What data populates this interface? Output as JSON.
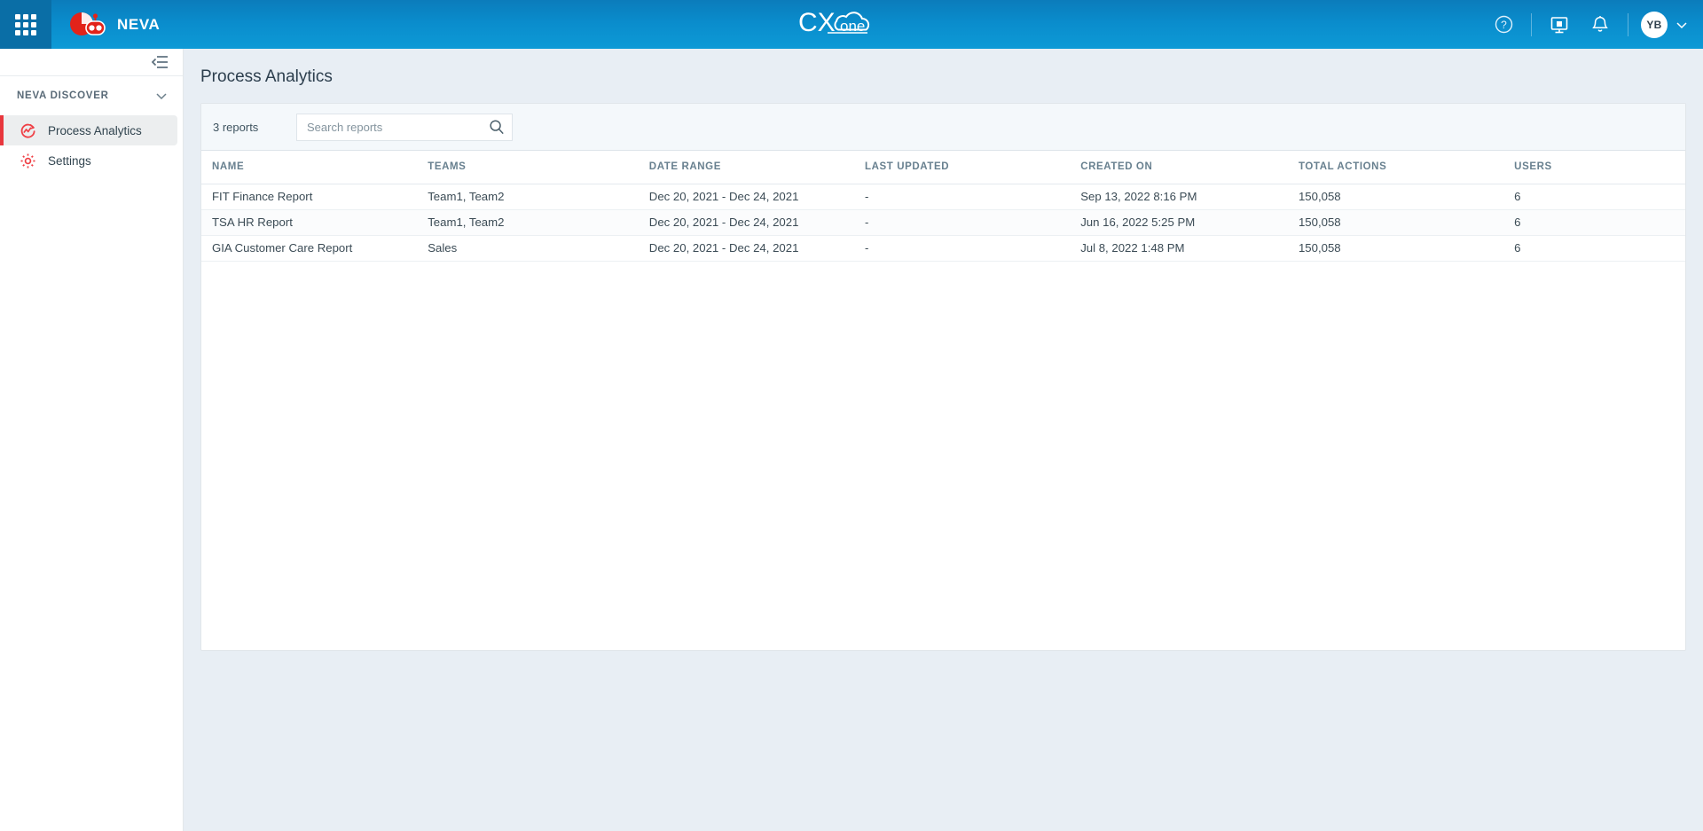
{
  "topbar": {
    "apps_launcher_name": "App launcher",
    "brand_name": "NEVA",
    "product_logo_main": "CX",
    "product_logo_sub": "one",
    "help_icon": "help-circle-icon",
    "dashboard_icon": "presentation-screen-icon",
    "notifications_icon": "bell-icon",
    "avatar_initials": "YB",
    "avatar_chevron": "chevron-down-icon"
  },
  "sidebar": {
    "collapse_icon": "collapse-panel-icon",
    "section": {
      "label": "NEVA DISCOVER",
      "chevron": "chevron-down-icon"
    },
    "items": [
      {
        "label": "Process Analytics",
        "icon": "process-analytics-icon",
        "selected": true
      },
      {
        "label": "Settings",
        "icon": "gear-icon",
        "selected": false
      }
    ]
  },
  "main": {
    "page_title": "Process Analytics",
    "toolbar": {
      "reports_count": "3 reports",
      "search_placeholder": "Search reports",
      "search_value": "",
      "search_icon": "search-icon"
    },
    "table": {
      "columns": [
        "NAME",
        "TEAMS",
        "DATE RANGE",
        "LAST UPDATED",
        "CREATED ON",
        "TOTAL ACTIONS",
        "USERS"
      ],
      "rows": [
        {
          "name": "FIT Finance Report",
          "teams": "Team1, Team2",
          "date_range": "Dec 20, 2021 - Dec 24, 2021",
          "last_updated": "-",
          "created_on": "Sep 13, 2022 8:16 PM",
          "total_actions": "150,058",
          "users": "6"
        },
        {
          "name": "TSA HR Report",
          "teams": "Team1, Team2",
          "date_range": "Dec 20, 2021 - Dec 24, 2021",
          "last_updated": "-",
          "created_on": "Jun 16, 2022 5:25 PM",
          "total_actions": "150,058",
          "users": "6"
        },
        {
          "name": "GIA Customer Care Report",
          "teams": "Sales",
          "date_range": "Dec 20, 2021 - Dec 24, 2021",
          "last_updated": "-",
          "created_on": "Jul 8, 2022 1:48 PM",
          "total_actions": "150,058",
          "users": "6"
        }
      ]
    }
  },
  "colors": {
    "topbar_blue": "#0a8ccc",
    "accent_red": "#e8373d",
    "page_bg": "#e8eef4",
    "card_bg": "#ffffff",
    "text_primary": "#3b4b55",
    "text_muted": "#68808f"
  }
}
